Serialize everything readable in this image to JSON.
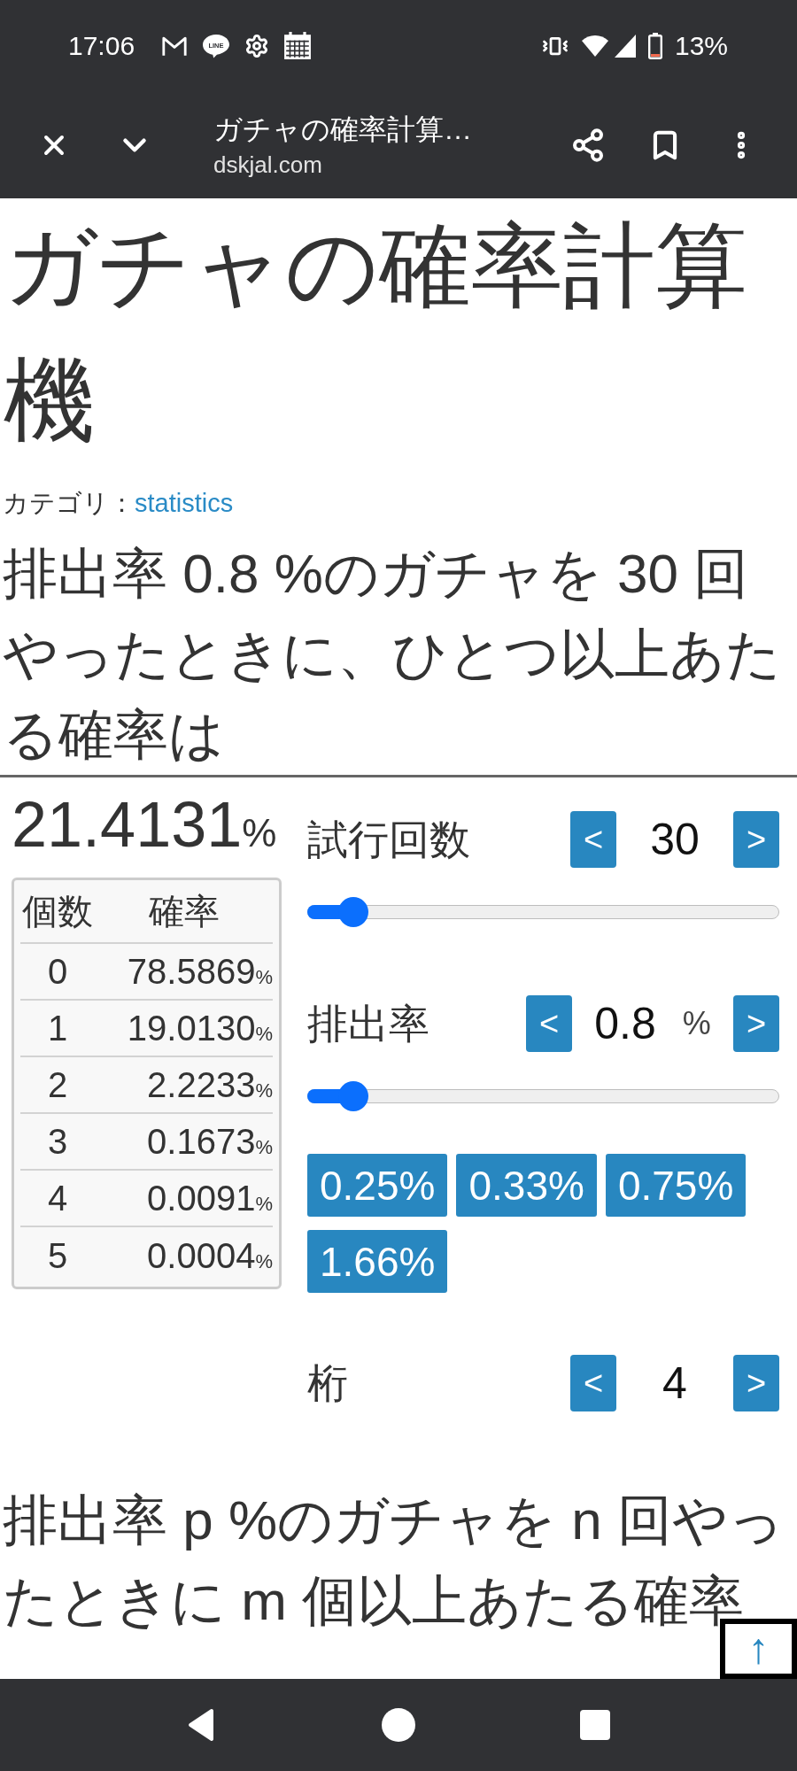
{
  "status_bar": {
    "time": "17:06",
    "chat_badge": "LINE",
    "battery": "13%"
  },
  "toolbar": {
    "title": "ガチャの確率計算…",
    "url": "dskjal.com"
  },
  "article": {
    "title": "ガチャの確率計算機",
    "category_label": "カテゴリ：",
    "category_link": "statistics",
    "question": "排出率 0.8 %のガチャを 30 回やったときに、ひとつ以上あたる確率は"
  },
  "result": {
    "value": "21.4131",
    "unit": "%"
  },
  "table": {
    "columns": [
      "個数",
      "確率"
    ],
    "rows": [
      {
        "count": "0",
        "probability": "78.5869",
        "unit": "%"
      },
      {
        "count": "1",
        "probability": "19.0130",
        "unit": "%"
      },
      {
        "count": "2",
        "probability": "2.2233",
        "unit": "%"
      },
      {
        "count": "3",
        "probability": "0.1673",
        "unit": "%"
      },
      {
        "count": "4",
        "probability": "0.0091",
        "unit": "%"
      },
      {
        "count": "5",
        "probability": "0.0004",
        "unit": "%"
      }
    ]
  },
  "controls": [
    {
      "kind": "stepper_slider",
      "label": "試行回数",
      "prev": "<",
      "value": "30",
      "next": ">",
      "level": 0.07
    },
    {
      "kind": "stepper_slider",
      "label": "排出率",
      "prev": "<",
      "value": "0.8",
      "unit": "%",
      "next": ">",
      "level": 0.07
    },
    {
      "kind": "presets",
      "buttons": [
        "0.25%",
        "0.33%",
        "0.75%",
        "1.66%"
      ]
    },
    {
      "kind": "stepper",
      "label": "桁",
      "prev": "<",
      "value": "4",
      "next": ">"
    }
  ],
  "formula_heading": "排出率 p %のガチャを n 回やったときに m 個以上あたる確率",
  "scroll_top_button": "↑"
}
